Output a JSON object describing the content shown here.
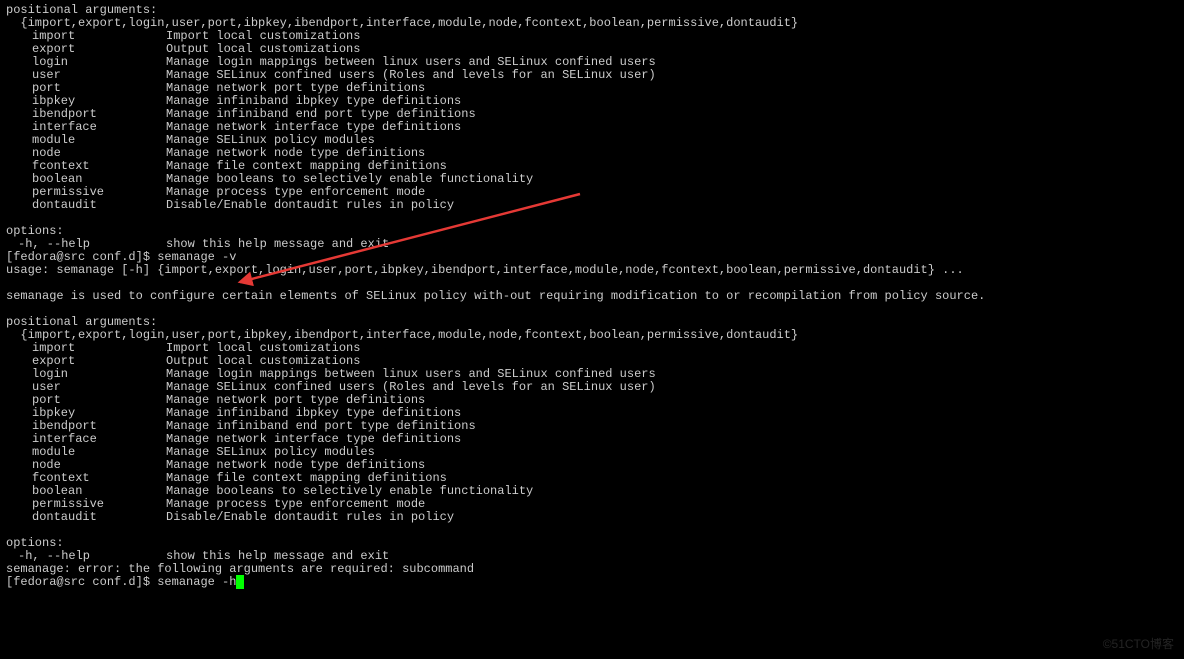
{
  "block1": {
    "pos_header": "positional arguments:",
    "pos_list": "  {import,export,login,user,port,ibpkey,ibendport,interface,module,node,fcontext,boolean,permissive,dontaudit}",
    "subs": [
      {
        "label": "import",
        "desc": "Import local customizations"
      },
      {
        "label": "export",
        "desc": "Output local customizations"
      },
      {
        "label": "login",
        "desc": "Manage login mappings between linux users and SELinux confined users"
      },
      {
        "label": "user",
        "desc": "Manage SELinux confined users (Roles and levels for an SELinux user)"
      },
      {
        "label": "port",
        "desc": "Manage network port type definitions"
      },
      {
        "label": "ibpkey",
        "desc": "Manage infiniband ibpkey type definitions"
      },
      {
        "label": "ibendport",
        "desc": "Manage infiniband end port type definitions"
      },
      {
        "label": "interface",
        "desc": "Manage network interface type definitions"
      },
      {
        "label": "module",
        "desc": "Manage SELinux policy modules"
      },
      {
        "label": "node",
        "desc": "Manage network node type definitions"
      },
      {
        "label": "fcontext",
        "desc": "Manage file context mapping definitions"
      },
      {
        "label": "boolean",
        "desc": "Manage booleans to selectively enable functionality"
      },
      {
        "label": "permissive",
        "desc": "Manage process type enforcement mode"
      },
      {
        "label": "dontaudit",
        "desc": "Disable/Enable dontaudit rules in policy"
      }
    ],
    "opt_header": "options:",
    "opt_help_label": "-h, --help",
    "opt_help_desc": "show this help message and exit"
  },
  "prompt1": {
    "text": "[fedora@src conf.d]$ ",
    "cmd": "semanage -v"
  },
  "usage": "usage: semanage [-h] {import,export,login,user,port,ibpkey,ibendport,interface,module,node,fcontext,boolean,permissive,dontaudit} ...",
  "desc": "semanage is used to configure certain elements of SELinux policy with-out requiring modification to or recompilation from policy source.",
  "block2": {
    "pos_header": "positional arguments:",
    "pos_list": "  {import,export,login,user,port,ibpkey,ibendport,interface,module,node,fcontext,boolean,permissive,dontaudit}",
    "subs": [
      {
        "label": "import",
        "desc": "Import local customizations"
      },
      {
        "label": "export",
        "desc": "Output local customizations"
      },
      {
        "label": "login",
        "desc": "Manage login mappings between linux users and SELinux confined users"
      },
      {
        "label": "user",
        "desc": "Manage SELinux confined users (Roles and levels for an SELinux user)"
      },
      {
        "label": "port",
        "desc": "Manage network port type definitions"
      },
      {
        "label": "ibpkey",
        "desc": "Manage infiniband ibpkey type definitions"
      },
      {
        "label": "ibendport",
        "desc": "Manage infiniband end port type definitions"
      },
      {
        "label": "interface",
        "desc": "Manage network interface type definitions"
      },
      {
        "label": "module",
        "desc": "Manage SELinux policy modules"
      },
      {
        "label": "node",
        "desc": "Manage network node type definitions"
      },
      {
        "label": "fcontext",
        "desc": "Manage file context mapping definitions"
      },
      {
        "label": "boolean",
        "desc": "Manage booleans to selectively enable functionality"
      },
      {
        "label": "permissive",
        "desc": "Manage process type enforcement mode"
      },
      {
        "label": "dontaudit",
        "desc": "Disable/Enable dontaudit rules in policy"
      }
    ],
    "opt_header": "options:",
    "opt_help_label": "-h, --help",
    "opt_help_desc": "show this help message and exit"
  },
  "error_line": "semanage: error: the following arguments are required: subcommand",
  "prompt2": {
    "text": "[fedora@src conf.d]$ ",
    "cmd": "semanage -h"
  },
  "watermark": "©51CTO博客"
}
